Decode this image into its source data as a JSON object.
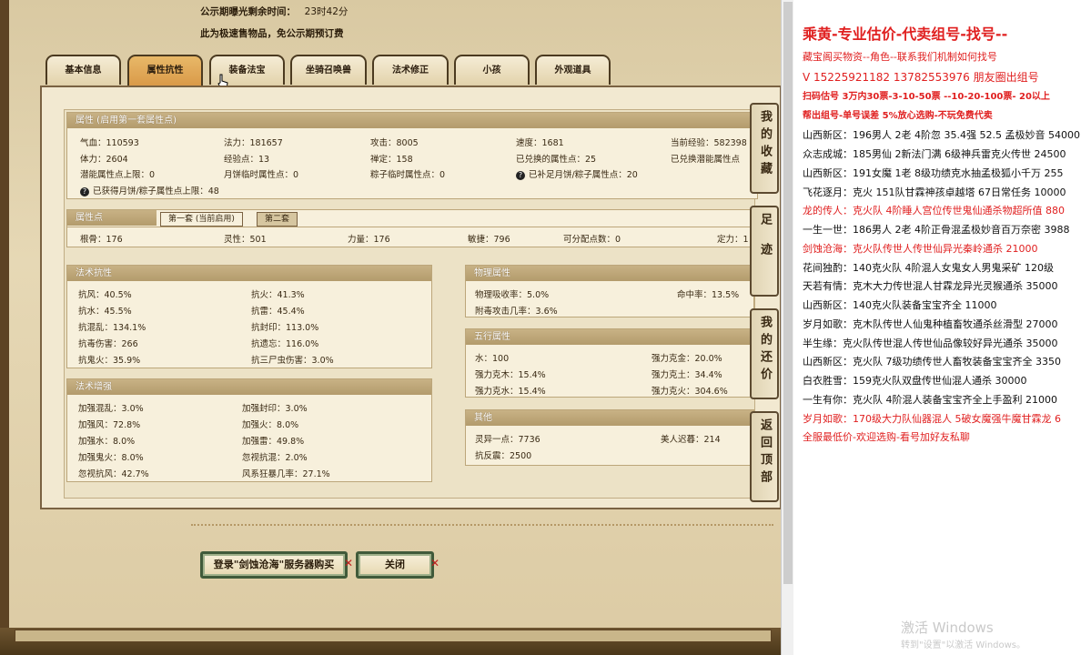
{
  "header": {
    "countdown_label": "公示期曝光剩余时间：",
    "countdown_value": "23时42分",
    "notice": "此为极速售物品，免公示期预订费"
  },
  "tabs": [
    "基本信息",
    "属性抗性",
    "装备法宝",
    "坐骑召唤兽",
    "法术修正",
    "小孩",
    "外观道具"
  ],
  "active_tab": "属性抗性",
  "attr": {
    "title": "属性 (启用第一套属性点)",
    "rows": [
      [
        "气血：110593",
        "法力：181657",
        "攻击：8005",
        "速度：1681",
        "当前经验：582398"
      ],
      [
        "体力：2604",
        "经验点：13",
        "禅定：158",
        "已兑换的属性点：25",
        "已兑换潜能属性点"
      ],
      [
        "潜能属性点上限：0",
        "月饼临时属性点：0",
        "粽子临时属性点：0",
        "已补足月饼/粽子属性点：20"
      ]
    ],
    "note": "已获得月饼/粽子属性点上限：48"
  },
  "points": {
    "title": "属性点",
    "tab1": "第一套 (当前启用)",
    "tab2": "第二套",
    "values": [
      "根骨：176",
      "灵性：501",
      "力量：176",
      "敏捷：796",
      "可分配点数：0",
      "定力：1"
    ]
  },
  "resist": {
    "title": "法术抗性",
    "rows": [
      [
        "抗风：40.5%",
        "抗火：41.3%"
      ],
      [
        "抗水：45.5%",
        "抗雷：45.4%"
      ],
      [
        "抗混乱：134.1%",
        "抗封印：113.0%"
      ],
      [
        "抗毒伤害：266",
        "抗遗忘：116.0%"
      ],
      [
        "抗鬼火：35.9%",
        "抗三尸虫伤害：3.0%"
      ]
    ]
  },
  "enhance": {
    "title": "法术增强",
    "rows": [
      [
        "加强混乱：3.0%",
        "加强封印：3.0%"
      ],
      [
        "加强风：72.8%",
        "加强火：8.0%"
      ],
      [
        "加强水：8.0%",
        "加强雷：49.8%"
      ],
      [
        "加强鬼火：8.0%",
        "忽视抗混：2.0%"
      ],
      [
        "忽视抗风：42.7%",
        "风系狂暴几率：27.1%"
      ]
    ]
  },
  "physical": {
    "title": "物理属性",
    "rows": [
      [
        "物理吸收率：5.0%",
        "命中率：13.5%"
      ],
      [
        "附毒攻击几率：3.6%",
        ""
      ]
    ]
  },
  "five": {
    "title": "五行属性",
    "rows": [
      [
        "水：100",
        "强力克金：20.0%"
      ],
      [
        "强力克木：15.4%",
        "强力克土：34.4%"
      ],
      [
        "强力克水：15.4%",
        "强力克火：304.6%"
      ]
    ]
  },
  "other": {
    "title": "其他",
    "rows": [
      [
        "灵异一点：7736",
        "美人迟暮：214"
      ],
      [
        "抗反震：2500",
        ""
      ]
    ]
  },
  "side": [
    "我的收藏",
    "足迹",
    "我的还价",
    "返回顶部"
  ],
  "buttons": {
    "buy": "登录\"剑蚀沧海\"服务器购买",
    "close": "关闭"
  },
  "ad": {
    "title": "乘黄-专业估价-代卖组号-找号--",
    "lines": [
      {
        "t": "藏宝阁买物资--角色--联系我们机制如何找号",
        "c": "red"
      },
      {
        "t": "V 15225921182  13782553976 朋友圈出组号",
        "c": "red"
      },
      {
        "t": "扫码估号 3万内30票-3-10-50票 --10-20-100票- 20以上",
        "c": "redb"
      },
      {
        "t": "帮出组号-单号误差 5%放心选购-不玩免费代卖",
        "c": "redb"
      },
      {
        "t": "山西新区：196男人 2老 4阶忽 35.4强 52.5 孟极妙音 54000",
        "c": ""
      },
      {
        "t": "众志成城：185男仙 2新法门满 6级神兵雷克火传世 24500",
        "c": ""
      },
      {
        "t": "山西新区：191女魔 1老 8级功绩克水抽孟极狐小千万 255",
        "c": ""
      },
      {
        "t": "飞花逐月：克火 151队甘霖神孩卓越塔 67日常任务 10000",
        "c": ""
      },
      {
        "t": "龙的传人：克火队 4阶睡人宫位传世鬼仙通杀物超所值 880",
        "c": "red"
      },
      {
        "t": "一生一世：186男人 2老 4阶正骨混孟极妙音百万奈密 3988",
        "c": ""
      },
      {
        "t": "剑蚀沧海：克火队传世人传世仙异光秦岭通杀 21000",
        "c": "red"
      },
      {
        "t": "花间独酌：140克火队 4阶混人女鬼女人男鬼采矿 120级",
        "c": ""
      },
      {
        "t": "天若有情：克木大力传世混人甘霖龙异光灵猴通杀 35000",
        "c": ""
      },
      {
        "t": "山西新区：140克火队装备宝宝齐全 11000",
        "c": ""
      },
      {
        "t": "岁月如歌：克木队传世人仙鬼种植畜牧通杀丝滑型 27000",
        "c": ""
      },
      {
        "t": "半生缘：克火队传世混人传世仙品像较好异光通杀 35000",
        "c": ""
      },
      {
        "t": "山西新区：克火队 7级功绩传世人畜牧装备宝宝齐全 3350",
        "c": ""
      },
      {
        "t": "白衣胜雪：159克火队双盘传世仙混人通杀 30000",
        "c": ""
      },
      {
        "t": "一生有你：克火队 4阶混人装备宝宝齐全上手盈利 21000",
        "c": ""
      },
      {
        "t": "岁月如歌：170级大力队仙器混人 5破女魔强牛魔甘霖龙 6",
        "c": "red"
      },
      {
        "t": "全服最低价-欢迎选购-看号加好友私聊",
        "c": "red"
      }
    ]
  },
  "watermark": {
    "line1": "激活 Windows",
    "line2": "转到\"设置\"以激活 Windows。"
  }
}
